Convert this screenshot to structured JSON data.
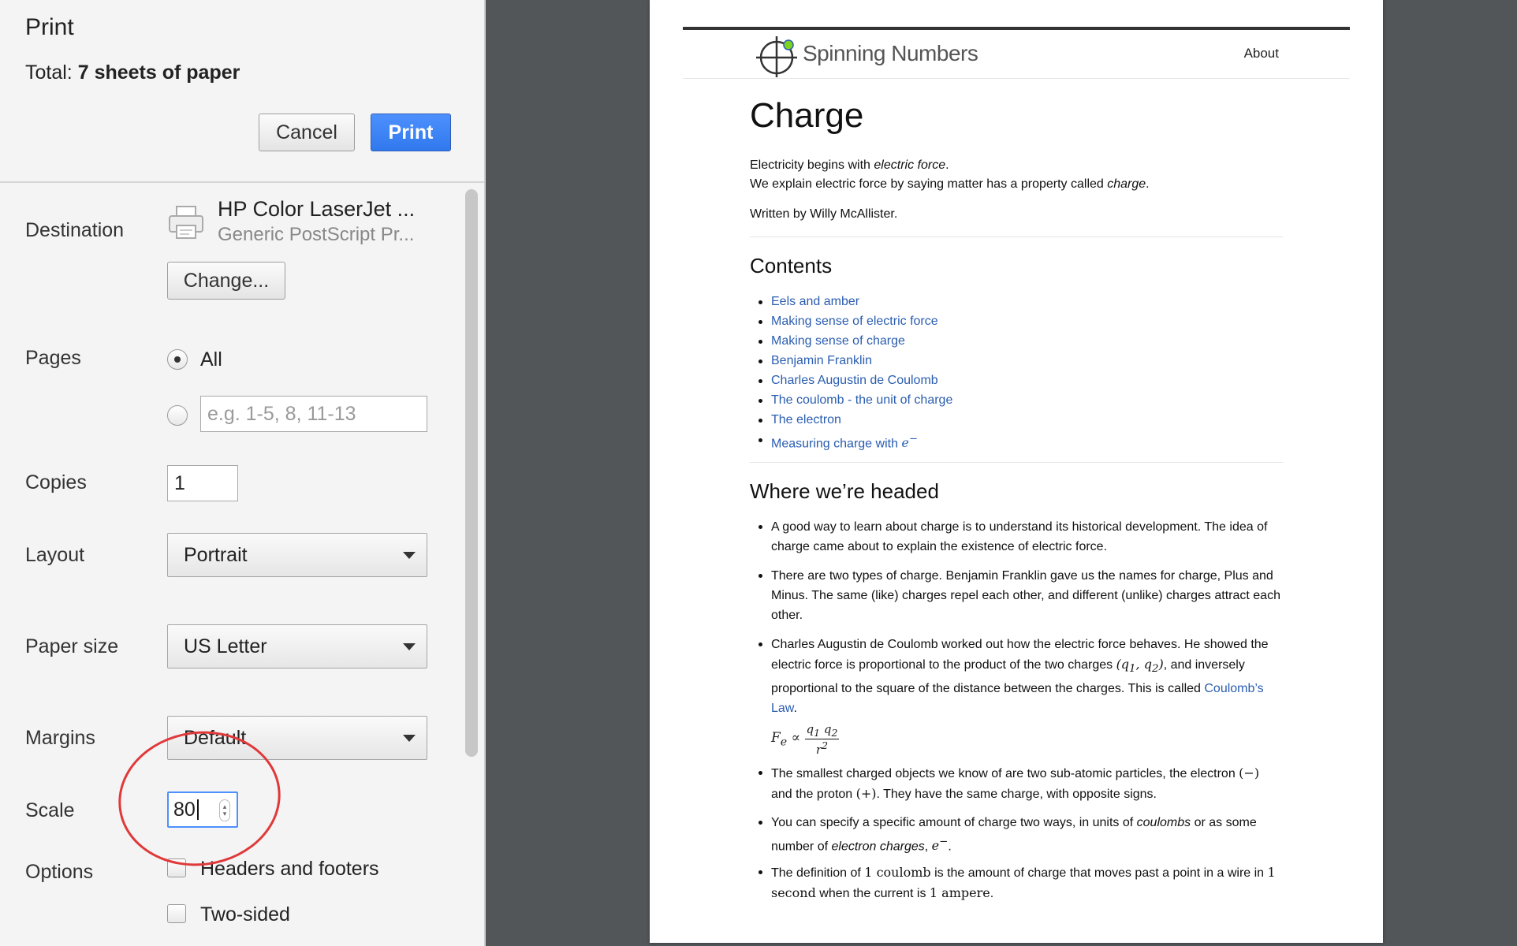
{
  "dialog": {
    "title": "Print",
    "total_label": "Total:",
    "total_value": "7 sheets of paper",
    "cancel_label": "Cancel",
    "print_label": "Print"
  },
  "destination": {
    "label": "Destination",
    "printer_name": "HP Color LaserJet ...",
    "printer_driver": "Generic PostScript Pr...",
    "change_label": "Change..."
  },
  "pages": {
    "label": "Pages",
    "all_label": "All",
    "selected": "All",
    "custom_placeholder": "e.g. 1-5, 8, 11-13"
  },
  "copies": {
    "label": "Copies",
    "value": "1"
  },
  "layout": {
    "label": "Layout",
    "value": "Portrait"
  },
  "paper_size": {
    "label": "Paper size",
    "value": "US Letter"
  },
  "margins": {
    "label": "Margins",
    "value": "Default"
  },
  "scale": {
    "label": "Scale",
    "value": "80"
  },
  "options": {
    "label": "Options",
    "headers_footers_label": "Headers and footers",
    "headers_footers_checked": false,
    "two_sided_label": "Two-sided",
    "two_sided_checked": false
  },
  "preview": {
    "site_name": "Spinning Numbers",
    "nav_about": "About",
    "title": "Charge",
    "intro_line1_pre": "Electricity begins with ",
    "intro_line1_em": "electric force",
    "intro_line1_post": ".",
    "intro_line2_pre": "We explain electric force by saying matter has a property called ",
    "intro_line2_em": "charge",
    "intro_line2_post": ".",
    "author": "Written by Willy McAllister.",
    "contents_heading": "Contents",
    "toc": [
      "Eels and amber",
      "Making sense of electric force",
      "Making sense of charge",
      "Benjamin Franklin",
      "Charles Augustin de Coulomb",
      "The coulomb - the unit of charge",
      "The electron",
      "Measuring charge with "
    ],
    "headed_heading": "Where we’re headed",
    "b1": "A good way to learn about charge is to understand its historical development. The idea of charge came about to explain the existence of electric force.",
    "b2": "There are two types of charge. Benjamin Franklin gave us the names for charge, Plus and Minus. The same (like) charges repel each other, and different (unlike) charges attract each other.",
    "b3_part1": "Charles Augustin de Coulomb worked out how the electric force behaves. He showed the electric force is proportional to the product of the two charges ",
    "b3_part2": ", and inversely proportional to the square of the distance between the charges. This is called ",
    "b3_link": "Coulomb’s Law",
    "b3_end": ".",
    "b4_part1": "The smallest charged objects we know of are two sub-atomic particles, the electron ",
    "b4_part2": " and the proton ",
    "b4_part3": ". They have the same charge, with opposite signs.",
    "b5_part1": "You can specify a specific amount of charge two ways, in units of ",
    "b5_em1": "coulombs",
    "b5_part2": " or as some number of ",
    "b5_em2": "electron charges",
    "b5_part3": ", ",
    "b5_end": ".",
    "b6_part1": "The definition of ",
    "b6_math1": "1 coulomb",
    "b6_part2": " is the amount of charge that moves past a point in a wire in ",
    "b6_math2": "1 second",
    "b6_part3": " when the current is ",
    "b6_math3": "1 ampere",
    "b6_end": "."
  },
  "icons": {
    "printer": "printer-icon",
    "logo": "crosshair-logo-icon",
    "dropdown": "chevron-down-icon"
  },
  "colors": {
    "print_button": "#3079ed",
    "link": "#2a5db0",
    "annotation_circle": "#e0393a",
    "logo_dot": "#7ed321"
  }
}
